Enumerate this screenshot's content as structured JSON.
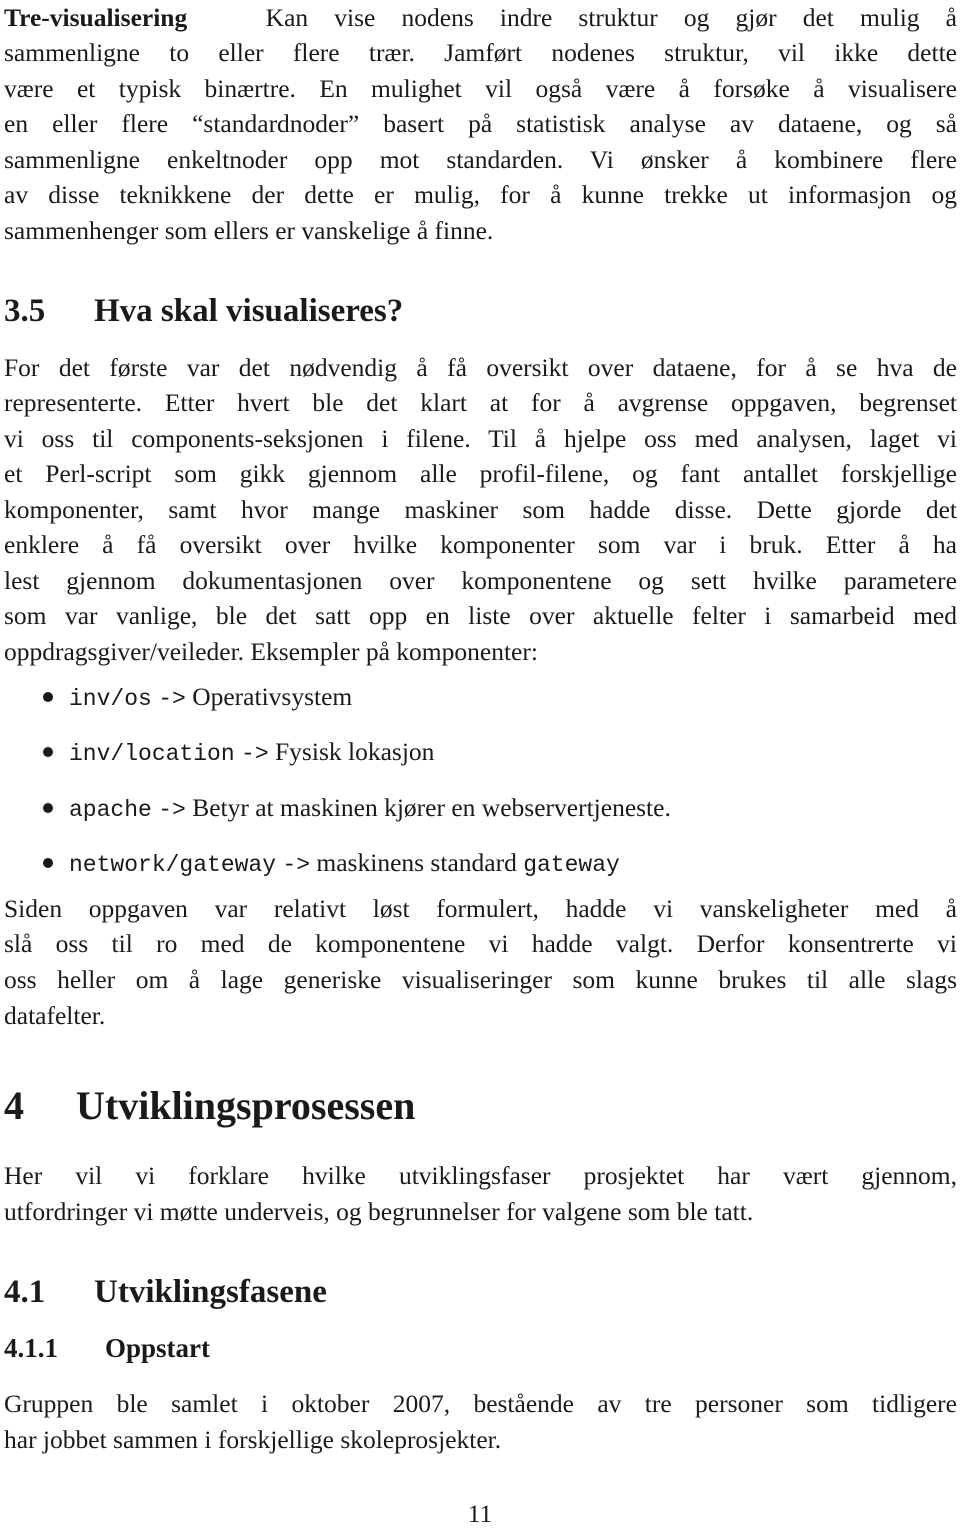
{
  "tree_para": {
    "term": "Tre-visualisering",
    "lines": [
      "Kan vise nodens indre struktur og gjør det mulig å",
      "sammenligne to eller flere trær. Jamført nodenes struktur, vil ikke dette",
      "være et typisk binærtre. En mulighet vil også være å forsøke å visualisere",
      "en eller flere “standardnoder” basert på statistisk analyse av dataene, og så",
      "sammenligne enkeltnoder opp mot standarden. Vi ønsker å kombinere flere",
      "av disse teknikkene der dette er mulig, for å kunne trekke ut informasjon og",
      "sammenhenger som ellers er vanskelige å finne."
    ]
  },
  "section_3_5": {
    "number": "3.5",
    "title": "Hva skal visualiseres?",
    "para1_lines": [
      "For det første var det nødvendig å få oversikt over dataene, for å se hva de",
      "representerte. Etter hvert ble det klart at for å avgrense oppgaven, begrenset",
      "vi oss til components-seksjonen i filene. Til å hjelpe oss med analysen, laget vi",
      "et Perl-script som gikk gjennom alle profil-filene, og fant antallet forskjellige",
      "komponenter, samt hvor mange maskiner som hadde disse. Dette gjorde det",
      "enklere å få oversikt over hvilke komponenter som var i bruk. Etter å ha",
      "lest gjennom dokumentasjonen over komponentene og sett hvilke parametere",
      "som var vanlige, ble det satt opp en liste over aktuelle felter i samarbeid med",
      "oppdragsgiver/veileder. Eksempler på komponenter:"
    ],
    "bullets": [
      {
        "code": "inv/os",
        "arrow": "->",
        "text": "Operativsystem",
        "code_suffix": ""
      },
      {
        "code": "inv/location",
        "arrow": "->",
        "text": "Fysisk lokasjon",
        "code_suffix": ""
      },
      {
        "code": "apache",
        "arrow": "->",
        "text": "Betyr at maskinen kjører en webservertjeneste.",
        "code_suffix": ""
      },
      {
        "code": "network/gateway",
        "arrow": "->",
        "text": "maskinens standard",
        "code_suffix": "gateway"
      }
    ],
    "para2_lines": [
      "Siden oppgaven var relativt løst formulert, hadde vi vanskeligheter med å",
      "slå oss til ro med de komponentene vi hadde valgt. Derfor konsentrerte vi",
      "oss heller om å lage generiske visualiseringer som kunne brukes til alle slags",
      "datafelter."
    ]
  },
  "section_4": {
    "number": "4",
    "title": "Utviklingsprosessen",
    "para_lines": [
      "Her vil vi forklare hvilke utviklingsfaser prosjektet har vært gjennom,",
      "utfordringer vi møtte underveis, og begrunnelser for valgene som ble tatt."
    ]
  },
  "section_4_1": {
    "number": "4.1",
    "title": "Utviklingsfasene"
  },
  "section_4_1_1": {
    "number": "4.1.1",
    "title": "Oppstart",
    "para_lines": [
      "Gruppen ble samlet i oktober 2007, bestående av tre personer som tidligere",
      "har jobbet sammen i forskjellige skoleprosjekter."
    ]
  },
  "page_number": "11"
}
